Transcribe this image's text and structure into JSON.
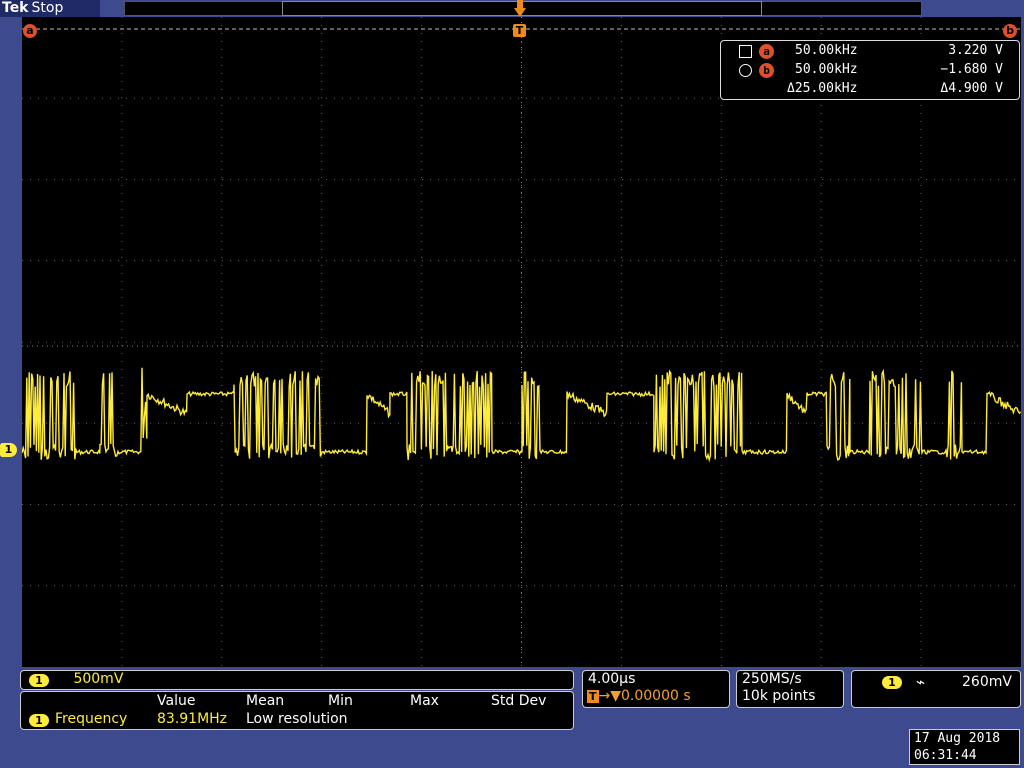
{
  "header": {
    "brand": "Tek",
    "status": "Stop"
  },
  "cursors": {
    "a_label": "a",
    "b_label": "b",
    "trigger_label": "T",
    "rows": [
      {
        "symbol": "square",
        "badge": "a",
        "freq": "50.00kHz",
        "volt": "3.220 V"
      },
      {
        "symbol": "circle",
        "badge": "b",
        "freq": "50.00kHz",
        "volt": "−1.680 V"
      },
      {
        "symbol": "",
        "badge": "",
        "freq": "Δ25.00kHz",
        "volt": "Δ4.900 V"
      }
    ]
  },
  "channel": {
    "marker": "1",
    "scale": "500mV"
  },
  "measurement": {
    "headers": [
      "Value",
      "Mean",
      "Min",
      "Max",
      "Std Dev"
    ],
    "label": "Frequency",
    "value": "83.91MHz",
    "note": "Low resolution"
  },
  "timebase": {
    "per_div": "4.00µs",
    "trig_pos_icon": "T",
    "delay": "→▼0.00000 s"
  },
  "acquisition": {
    "rate": "250MS/s",
    "points": "10k points"
  },
  "trigger": {
    "source": "1",
    "slope_icon": "falling-edge",
    "slope_glyph": "⌁",
    "level": "260mV"
  },
  "clock": {
    "date": "17 Aug 2018",
    "time": "06:31:44"
  },
  "colors": {
    "trace": "#ffeb3b",
    "cursor": "#e05028",
    "trigger": "#f08a1a",
    "frame": "#3d4a8e"
  }
}
